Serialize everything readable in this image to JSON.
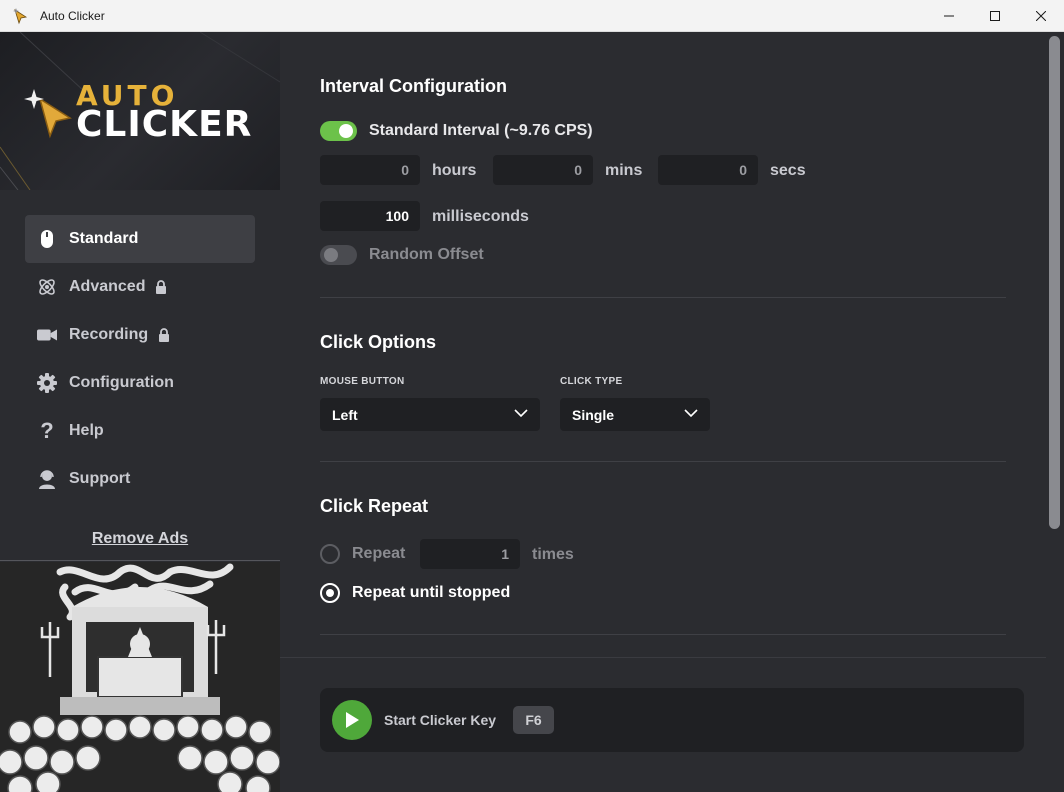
{
  "window": {
    "title": "Auto Clicker"
  },
  "logo": {
    "line1": "AUTO",
    "line2": "CLICKER"
  },
  "sidebar": {
    "items": [
      {
        "label": "Standard"
      },
      {
        "label": "Advanced"
      },
      {
        "label": "Recording"
      },
      {
        "label": "Configuration"
      },
      {
        "label": "Help"
      },
      {
        "label": "Support"
      }
    ],
    "remove_ads": "Remove Ads"
  },
  "interval": {
    "title": "Interval Configuration",
    "standard_label": "Standard Interval (~9.76 CPS)",
    "hours_value": "0",
    "hours_unit": "hours",
    "mins_value": "0",
    "mins_unit": "mins",
    "secs_value": "0",
    "secs_unit": "secs",
    "ms_value": "100",
    "ms_unit": "milliseconds",
    "random_offset_label": "Random Offset"
  },
  "click_options": {
    "title": "Click Options",
    "mouse_button_label": "MOUSE BUTTON",
    "mouse_button_value": "Left",
    "click_type_label": "CLICK TYPE",
    "click_type_value": "Single"
  },
  "click_repeat": {
    "title": "Click Repeat",
    "repeat_label": "Repeat",
    "repeat_value": "1",
    "repeat_unit": "times",
    "until_stopped_label": "Repeat until stopped"
  },
  "footer": {
    "start_label": "Start Clicker Key",
    "hotkey": "F6"
  },
  "colors": {
    "accent_green": "#6cc24a",
    "play_green": "#4fa83a",
    "bg": "#2b2c30"
  }
}
